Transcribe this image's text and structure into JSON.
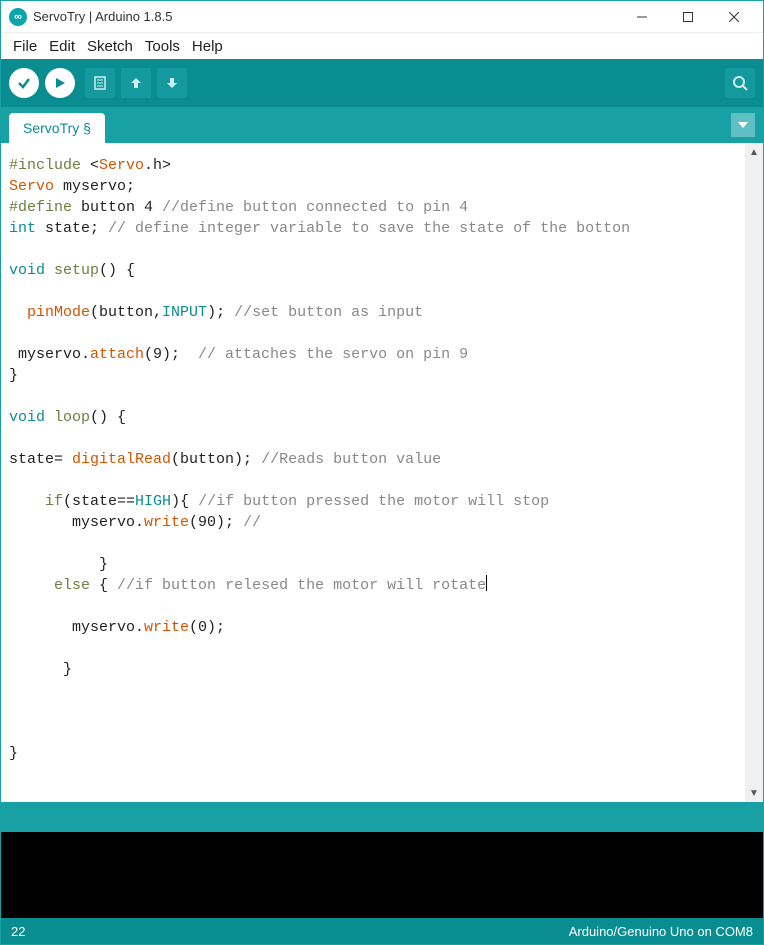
{
  "window": {
    "title": "ServoTry | Arduino 1.8.5"
  },
  "menu": {
    "file": "File",
    "edit": "Edit",
    "sketch": "Sketch",
    "tools": "Tools",
    "help": "Help"
  },
  "tab": {
    "name": "ServoTry §"
  },
  "status": {
    "line": "22",
    "board": "Arduino/Genuino Uno on COM8"
  },
  "code": {
    "l1_include": "#include",
    "l1_angle_open": " <",
    "l1_servo": "Servo",
    "l1_dot_h": ".h>",
    "l2_servo": "Servo",
    "l2_myservo": " myservo;",
    "l3_define": "#define",
    "l3_button": " button",
    "l3_four": " 4",
    "l3_cmt": " //define button connected to pin 4",
    "l4_int": "int",
    "l4_state": " state;",
    "l4_cmt": " // define integer variable to save the state of the botton",
    "l6_void": "void",
    "l6_setup": " setup",
    "l6_rest": "() {",
    "l8_indent": "  ",
    "l8_pinmode": "pinMode",
    "l8_open": "(button,",
    "l8_input": "INPUT",
    "l8_close": ");",
    "l8_cmt": " //set button as input",
    "l10_myservo": " myservo.",
    "l10_attach": "attach",
    "l10_args": "(9);  ",
    "l10_cmt": "// attaches the servo on pin 9",
    "l11_brace": "}",
    "l13_void": "void",
    "l13_loop": " loop",
    "l13_rest": "() {",
    "l15_state": "state= ",
    "l15_digitalread": "digitalRead",
    "l15_args": "(button);",
    "l15_cmt": " //Reads button value",
    "l17_indent": "    ",
    "l17_if": "if",
    "l17_cond_a": "(state==",
    "l17_high": "HIGH",
    "l17_cond_b": "){ ",
    "l17_cmt": "//if button pressed the motor will stop",
    "l18_indent": "       myservo.",
    "l18_write": "write",
    "l18_args": "(90); ",
    "l18_cmt": "//",
    "l20_brace": "          }",
    "l21_indent": "     ",
    "l21_else": "else",
    "l21_brace": " { ",
    "l21_cmt": "//if button relesed the motor will rotate",
    "l23_indent": "       myservo.",
    "l23_write": "write",
    "l23_args": "(0);",
    "l25_brace": "      }",
    "l29_brace": "}"
  }
}
